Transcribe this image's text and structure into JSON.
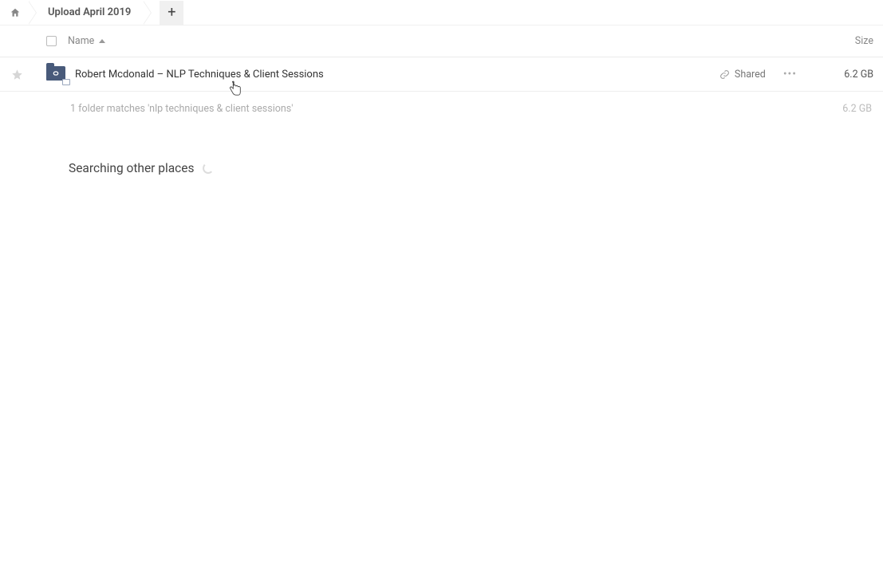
{
  "breadcrumb": {
    "current": "Upload April 2019"
  },
  "columns": {
    "name": "Name",
    "size": "Size"
  },
  "row": {
    "name": "Robert Mcdonald – NLP Techniques & Client Sessions",
    "shared_label": "Shared",
    "size": "6.2 GB"
  },
  "summary": {
    "text": "1 folder matches 'nlp techniques & client sessions'",
    "size": "6.2 GB"
  },
  "searching": {
    "label": "Searching other places"
  }
}
